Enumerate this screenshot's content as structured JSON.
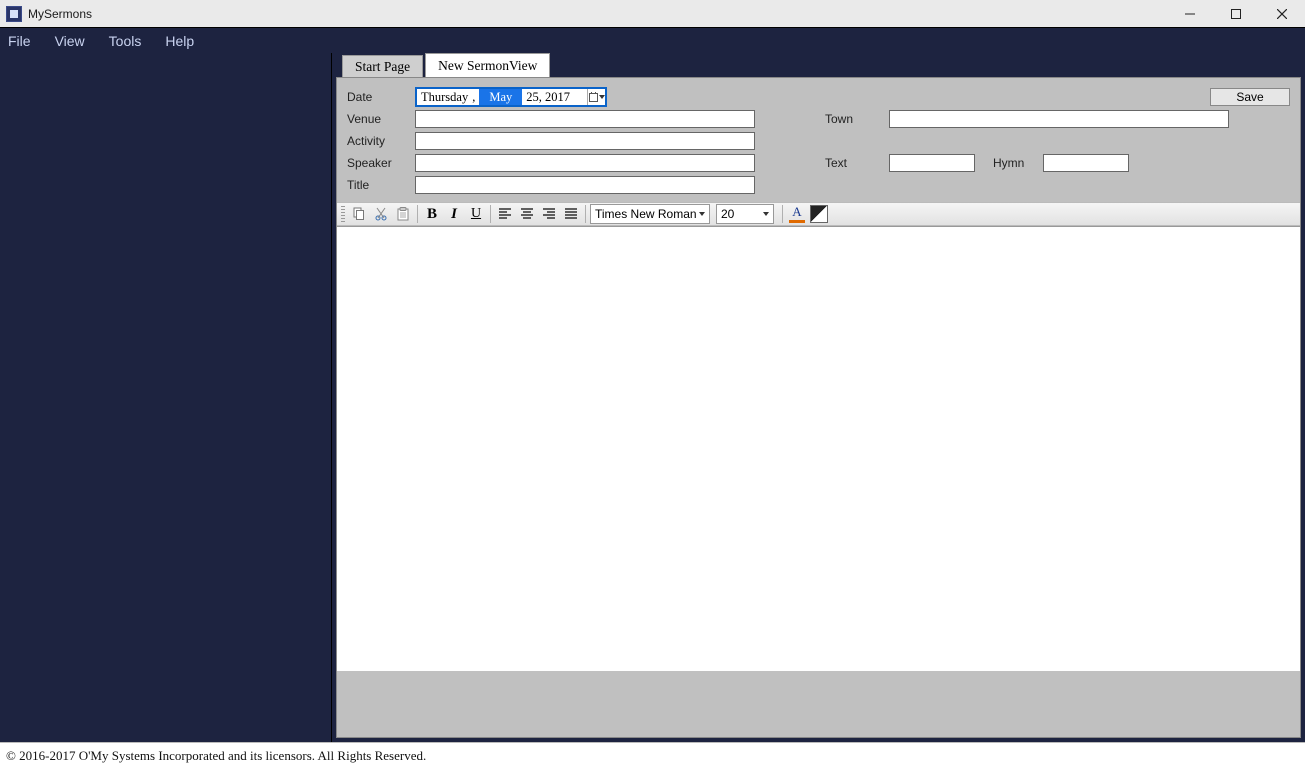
{
  "window": {
    "title": "MySermons"
  },
  "menu": {
    "items": [
      "File",
      "View",
      "Tools",
      "Help"
    ]
  },
  "tabs": {
    "start": "Start Page",
    "new": "New SermonView"
  },
  "form": {
    "labels": {
      "date": "Date",
      "venue": "Venue",
      "activity": "Activity",
      "speaker": "Speaker",
      "title": "Title",
      "town": "Town",
      "text": "Text",
      "hymn": "Hymn"
    },
    "date": {
      "weekday": "Thursday",
      "comma": ",",
      "month": "May",
      "rest": "25, 2017"
    },
    "values": {
      "venue": "",
      "activity": "",
      "speaker": "",
      "title": "",
      "town": "",
      "text": "",
      "hymn": ""
    },
    "save": "Save"
  },
  "editor": {
    "font": "Times New Roman",
    "size": "20",
    "body": ""
  },
  "footer": {
    "copyright": "© 2016-2017 O'My Systems Incorporated and its licensors. All Rights Reserved."
  }
}
